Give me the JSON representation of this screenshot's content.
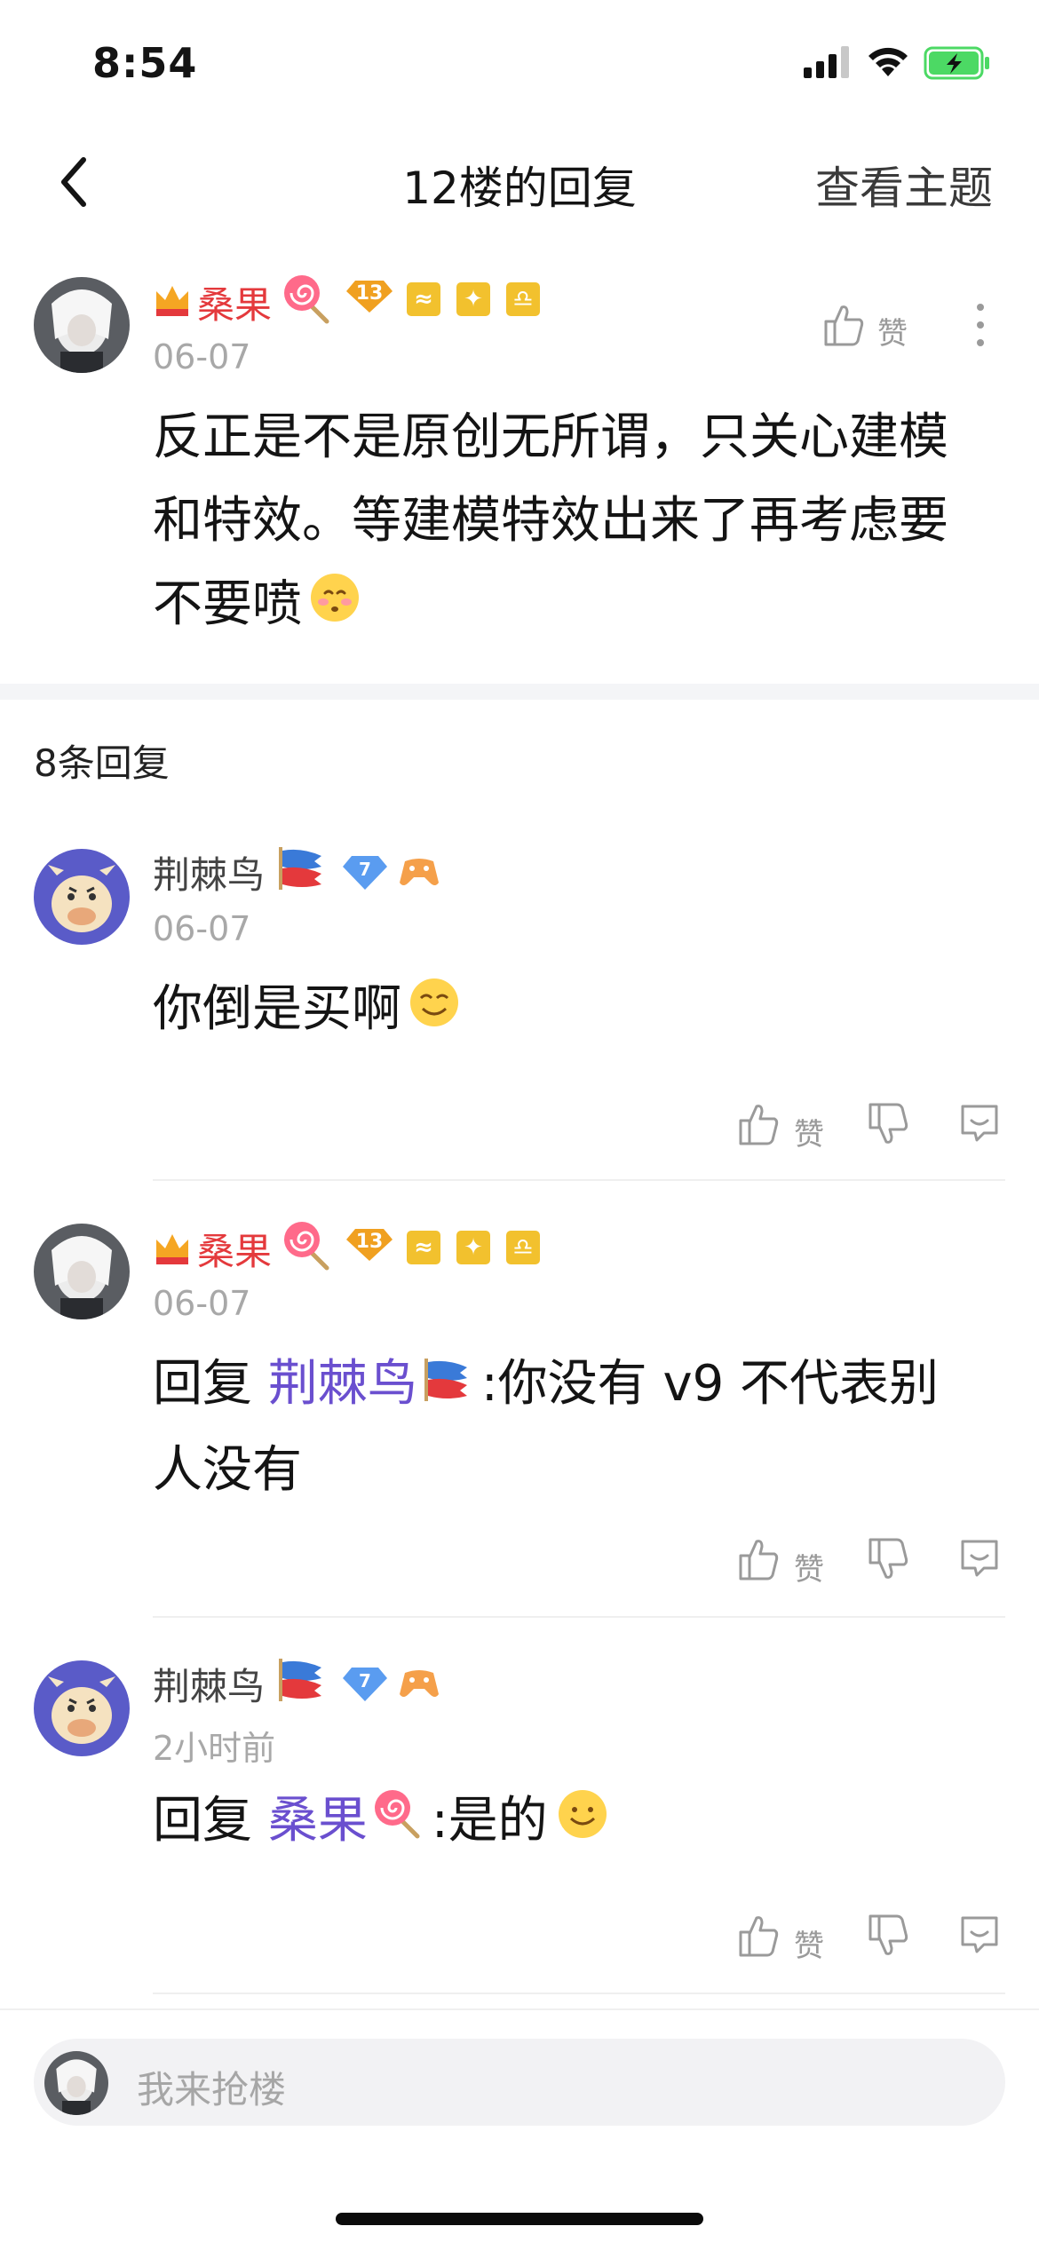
{
  "status_bar": {
    "time": "8:54"
  },
  "nav": {
    "title": "12楼的回复",
    "right": "查看主题"
  },
  "main_post": {
    "username": "桑果",
    "level": "13",
    "date": "06-07",
    "like_label": "赞",
    "content": "反正是不是原创无所谓，只关心建模和特效。等建模特效出来了再考虑要不要喷"
  },
  "replies_header": "8条回复",
  "replies": [
    {
      "username": "荆棘鸟",
      "level": "7",
      "date": "06-07",
      "content": "你倒是买啊",
      "like_label": "赞"
    },
    {
      "username": "桑果",
      "level": "13",
      "date": "06-07",
      "reply_prefix": "回复",
      "reply_to": "荆棘鸟",
      "content": ":你没有 v9 不代表别",
      "content_line2": "人没有",
      "like_label": "赞"
    },
    {
      "username": "荆棘鸟",
      "level": "7",
      "date": "2小时前",
      "reply_prefix": "回复",
      "reply_to": "桑果",
      "content": ":是的",
      "like_label": "赞"
    }
  ],
  "input": {
    "placeholder": "我来抢楼"
  },
  "colors": {
    "accent_red": "#e4393c",
    "link_purple": "#6a4fcf",
    "battery_green": "#4cd964"
  }
}
